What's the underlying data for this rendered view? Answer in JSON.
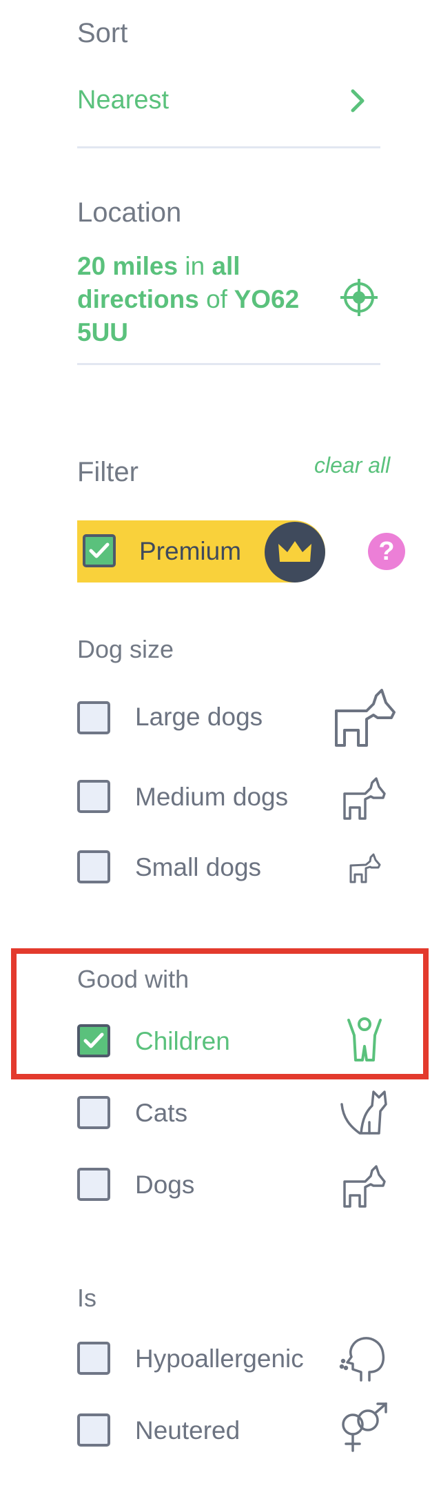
{
  "sort": {
    "title": "Sort",
    "value": "Nearest",
    "icon": "chevron-right-icon"
  },
  "location": {
    "title": "Location",
    "line1_bold": "20 miles",
    "line1_in": "in",
    "line1_all": "all",
    "line2_directions": "directions",
    "line2_of": "of",
    "line2_postcode": "YO62",
    "line3_postcode": "5UU",
    "icon": "compass-target-icon"
  },
  "filter": {
    "title": "Filter",
    "clear_all": "clear all",
    "premium": {
      "label": "Premium",
      "checked": true,
      "icon": "crown-icon",
      "help": "?"
    }
  },
  "dog_size": {
    "title": "Dog size",
    "options": [
      {
        "label": "Large dogs",
        "checked": false,
        "icon": "large-dog-icon"
      },
      {
        "label": "Medium dogs",
        "checked": false,
        "icon": "medium-dog-icon"
      },
      {
        "label": "Small dogs",
        "checked": false,
        "icon": "small-dog-icon"
      }
    ]
  },
  "good_with": {
    "title": "Good with",
    "options": [
      {
        "label": "Children",
        "checked": true,
        "icon": "child-icon"
      },
      {
        "label": "Cats",
        "checked": false,
        "icon": "cat-icon"
      },
      {
        "label": "Dogs",
        "checked": false,
        "icon": "dog-icon"
      }
    ]
  },
  "is": {
    "title": "Is",
    "options": [
      {
        "label": "Hypoallergenic",
        "checked": false,
        "icon": "sneezing-head-icon"
      },
      {
        "label": "Neutered",
        "checked": false,
        "icon": "gender-icon"
      }
    ]
  },
  "colors": {
    "accent_green": "#5ac17c",
    "premium_yellow": "#f9d13b",
    "help_pink": "#ec7fd7",
    "highlight_red": "#e33a2d",
    "checkbox_bg": "#e9eef8"
  }
}
